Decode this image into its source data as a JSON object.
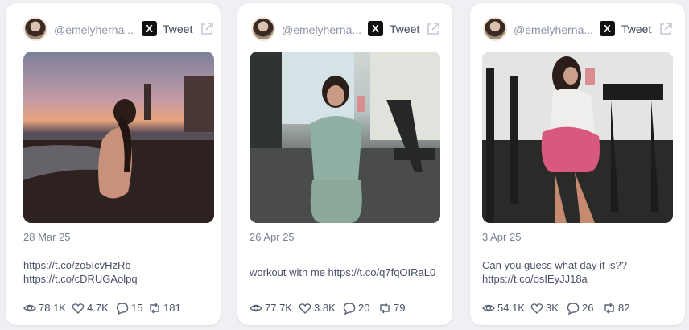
{
  "cards": [
    {
      "username": "@emelyherna...",
      "tweet_label": "Tweet",
      "date": "28 Mar 25",
      "text_lines": [
        "https://t.co/zo5IcvHzRb",
        "https://t.co/cDRUGAolpq"
      ],
      "views": "78.1K",
      "likes": "4.7K",
      "replies": "15",
      "retweets": "181"
    },
    {
      "username": "@emelyherna...",
      "tweet_label": "Tweet",
      "date": "26 Apr 25",
      "text_lines": [
        "workout with me https://t.co/q7fqOIRaL0"
      ],
      "views": "77.7K",
      "likes": "3.8K",
      "replies": "20",
      "retweets": "79"
    },
    {
      "username": "@emelyherna...",
      "tweet_label": "Tweet",
      "date": "3 Apr 25",
      "text_lines": [
        "Can you guess what day it is??",
        "https://t.co/osIEyJJ18a"
      ],
      "views": "54.1K",
      "likes": "3K",
      "replies": "26",
      "retweets": "82"
    }
  ],
  "icons": {
    "x_logo": "X",
    "views": "eye-icon",
    "likes": "heart-icon",
    "replies": "comment-icon",
    "retweets": "retweet-icon",
    "open": "external-link-icon"
  },
  "colors": {
    "background": "#eef0f4",
    "card": "#ffffff",
    "muted_text": "#8c93a4",
    "body_text": "#4a5266"
  }
}
